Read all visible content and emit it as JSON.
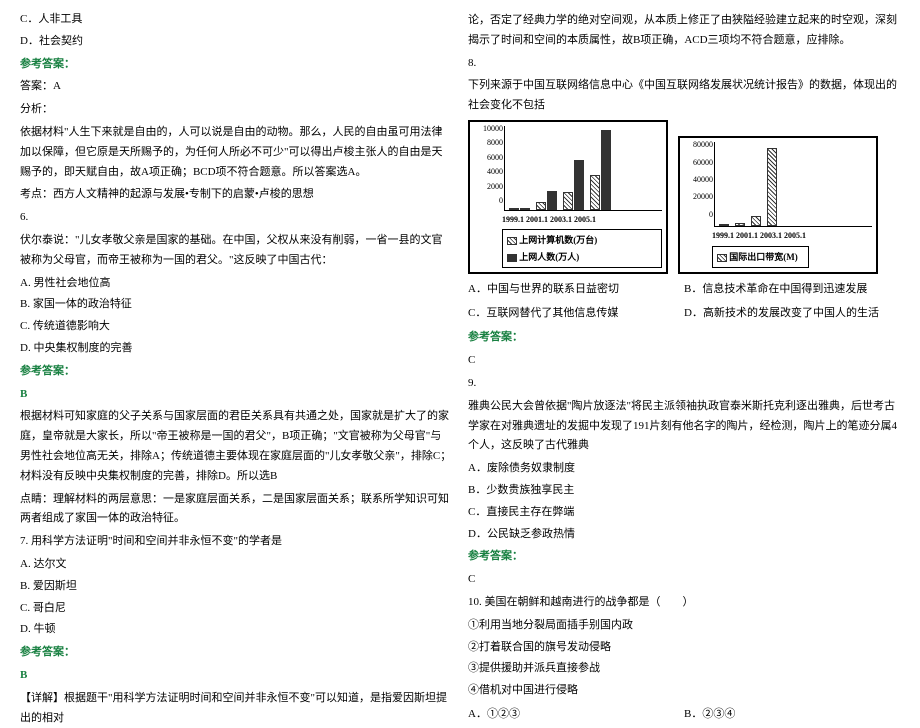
{
  "left": {
    "optC": "C．人非工具",
    "optD": "D．社会契约",
    "refAnswer": "参考答案：",
    "answerA": "答案：A",
    "analysisLabel": "分析：",
    "analysis": "依据材料\"人生下来就是自由的，人可以说是自由的动物。那么，人民的自由虽可用法律加以保障，但它原是天所赐予的，为任何人所必不可少\"可以得出卢梭主张人的自由是天赐予的，即天赋自由，故A项正确；BCD项不符合题意。所以答案选A。",
    "kaodian": "考点：西方人文精神的起源与发展•专制下的启蒙•卢梭的思想",
    "q6num": "6.",
    "q6text": "伏尔泰说：\"儿女孝敬父亲是国家的基础。在中国，父权从来没有削弱，一省一县的文官被称为父母官，而帝王被称为一国的君父。\"这反映了中国古代：",
    "q6a": "A. 男性社会地位高",
    "q6b": "B. 家国一体的政治特征",
    "q6c": "C. 传统道德影响大",
    "q6d": "D. 中央集权制度的完善",
    "q6answer": "B",
    "q6exp1": "根据材料可知家庭的父子关系与国家层面的君臣关系具有共通之处，国家就是扩大了的家庭，皇帝就是大家长，所以\"帝王被称是一国的君父\"，B项正确；\"文官被称为父母官\"与男性社会地位高无关，排除A；传统道德主要体现在家庭层面的\"儿女孝敬父亲\"，排除C；材料没有反映中央集权制度的完善，排除D。所以选B",
    "q6exp2": "点睛：理解材料的两层意思：一是家庭层面关系，二是国家层面关系；联系所学知识可知两者组成了家国一体的政治特征。",
    "q7text": "7. 用科学方法证明\"时间和空间并非永恒不变\"的学者是",
    "q7a": "A. 达尔文",
    "q7b": "B. 爱因斯坦",
    "q7c": "C. 哥白尼",
    "q7d": "D. 牛顿",
    "q7answer": "B",
    "q7exp": "【详解】根据题干\"用科学方法证明时间和空间并非永恒不变\"可以知道，是指爱因斯坦提出的相对"
  },
  "right": {
    "cont": "论，否定了经典力学的绝对空间观，从本质上修正了由狭隘经验建立起来的时空观，深刻揭示了时间和空间的本质属性，故B项正确，ACD三项均不符合题意，应排除。",
    "q8num": "8.",
    "q8text": "下列来源于中国互联网络信息中心《中国互联网络发展状况统计报告》的数据，体现出的社会变化不包括",
    "q8a": "A．中国与世界的联系日益密切",
    "q8b": "B．信息技术革命在中国得到迅速发展",
    "q8c": "C．互联网替代了其他信息传媒",
    "q8d": "D．高新技术的发展改变了中国人的生活",
    "q8answer": "C",
    "q9num": "9.",
    "q9text": "雅典公民大会曾依据\"陶片放逐法\"将民主派领袖执政官泰米斯托克利逐出雅典，后世考古学家在对雅典遗址的发掘中发现了191片刻有他名字的陶片，经检测，陶片上的笔迹分属4个人，这反映了古代雅典",
    "q9a": "A．废除债务奴隶制度",
    "q9b": "B．少数贵族独享民主",
    "q9c": "C．直接民主存在弊端",
    "q9d": "D．公民缺乏参政热情",
    "q9answer": "C",
    "q10text": "10. 美国在朝鲜和越南进行的战争都是（　　）",
    "q10_1": "①利用当地分裂局面插手别国内政",
    "q10_2": "②打着联合国的旗号发动侵略",
    "q10_3": "③提供援助并派兵直接参战",
    "q10_4": "④借机对中国进行侵略",
    "q10a": "A．①②③",
    "q10b": "B．②③④"
  },
  "chart_data": [
    {
      "type": "bar",
      "title": "",
      "categories": [
        "1999.1",
        "2001.1",
        "2003.1",
        "2005.1"
      ],
      "series": [
        {
          "name": "上网计算机数(万台)",
          "values": [
            75,
            892,
            2083,
            4160
          ]
        },
        {
          "name": "上网人数(万人)",
          "values": [
            210,
            2250,
            5910,
            9400
          ]
        }
      ],
      "ylim": [
        0,
        10000
      ],
      "yticks": [
        0,
        2000,
        4000,
        6000,
        8000,
        10000
      ],
      "legend": [
        "上网计算机数(万台)",
        "上网人数(万人)"
      ]
    },
    {
      "type": "bar",
      "title": "",
      "categories": [
        "1999.1",
        "2001.1",
        "2003.1",
        "2005.1"
      ],
      "series": [
        {
          "name": "国际出口带宽(M)",
          "values": [
            150,
            2800,
            9380,
            74000
          ]
        }
      ],
      "ylim": [
        0,
        80000
      ],
      "yticks": [
        0,
        20000,
        40000,
        60000,
        80000
      ],
      "legend": [
        "国际出口带宽(M)"
      ]
    }
  ]
}
